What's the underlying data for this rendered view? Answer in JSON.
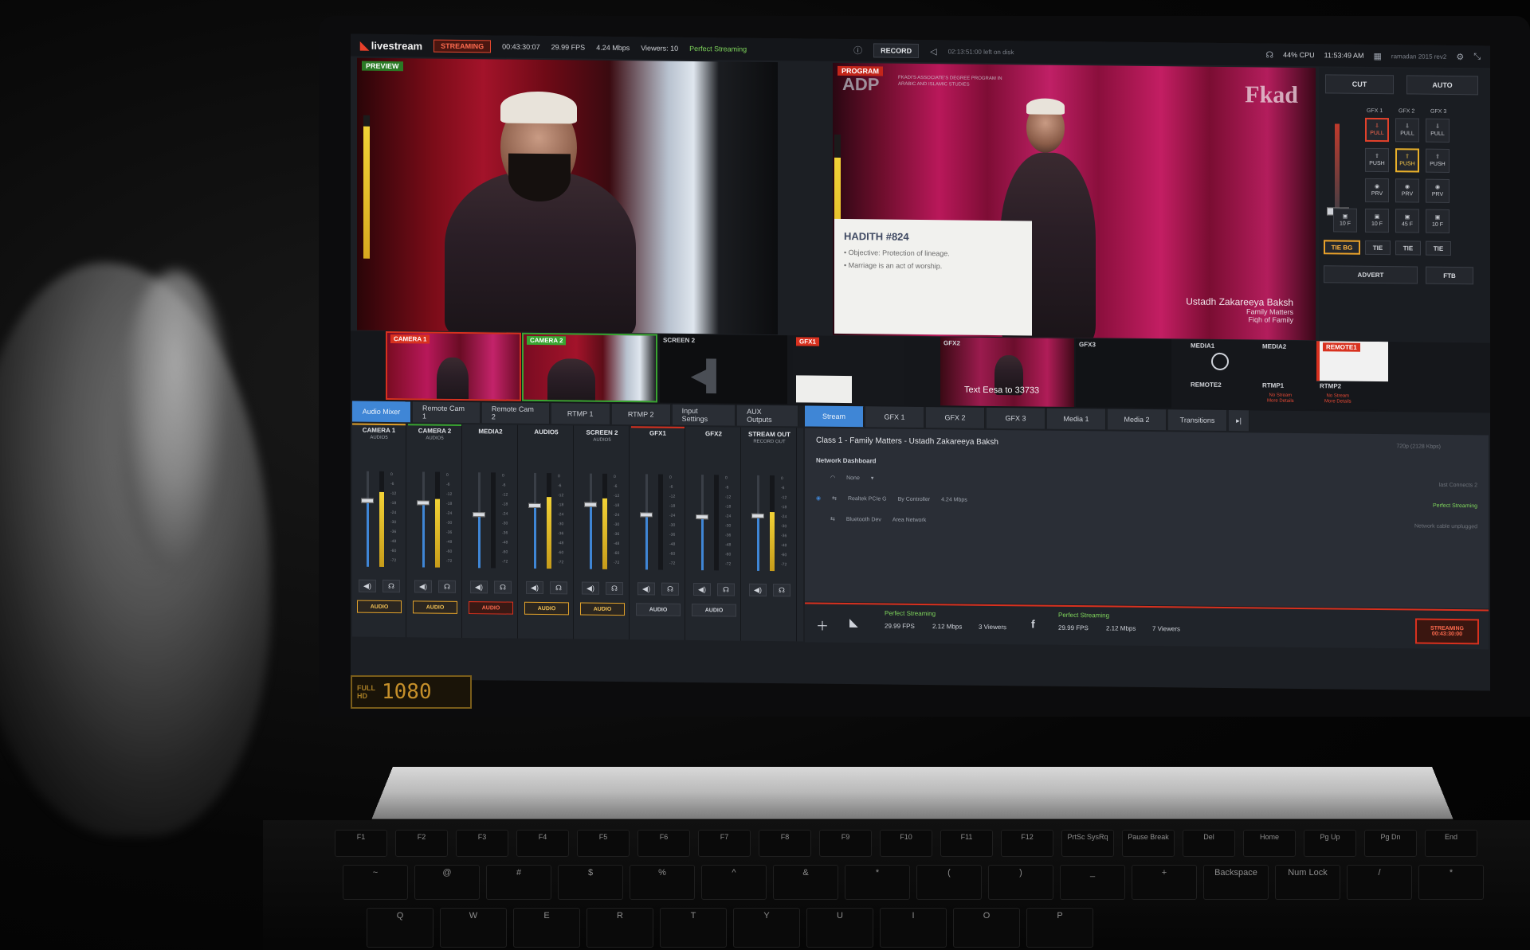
{
  "topbar": {
    "logo": "livestream",
    "streaming": "STREAMING",
    "timecode": "00:43:30:07",
    "fps": "29.99 FPS",
    "bitrate": "4.24 Mbps",
    "viewers": "Viewers: 10",
    "status": "Perfect Streaming",
    "record": "RECORD",
    "disk": "02:13:51:00 left on disk",
    "cpu": "44% CPU",
    "clock": "11:53:49 AM",
    "project": "ramadan 2015 rev2"
  },
  "preview": {
    "label": "PREVIEW"
  },
  "program": {
    "label": "PROGRAM",
    "adp": "ADP",
    "adp_sub": "FKADI'S ASSOCIATE'S DEGREE PROGRAM IN ARABIC AND ISLAMIC STUDIES",
    "brand": "Fkad",
    "card_title": "HADITH #824",
    "card_items": [
      "Objective: Protection of lineage.",
      "Marriage is an act of worship."
    ],
    "name": "Ustadh Zakareeya Baksh",
    "name_sub1": "Family Matters",
    "name_sub2": "Fiqh of Family"
  },
  "transition": {
    "cut": "CUT",
    "auto": "AUTO",
    "heads": [
      "GFX 1",
      "GFX 2",
      "GFX 3"
    ],
    "pull": "PULL",
    "push": "PUSH",
    "prv": "PRV",
    "frames": [
      "10 F",
      "10 F",
      "45 F",
      "10 F"
    ],
    "tie_bg": "TIE BG",
    "tie": "TIE",
    "advert": "ADVERT",
    "ftb": "FTB"
  },
  "sources": {
    "cam1": "CAMERA 1",
    "cam2": "CAMERA 2",
    "screen2": "SCREEN 2",
    "gfx1": "GFX1",
    "gfx2": "GFX2",
    "gfx2_caption": "Text Eesa to 33733",
    "gfx3": "GFX3",
    "media1": "MEDIA1",
    "media2": "MEDIA2",
    "remote1": "REMOTE1",
    "remote2": "REMOTE2",
    "rtmp1": "RTMP1",
    "rtmp2": "RTMP2",
    "no_stream": "No Stream",
    "more_details": "More Details"
  },
  "tabs_left": [
    "Audio Mixer",
    "Remote Cam 1",
    "Remote Cam 2",
    "RTMP 1",
    "RTMP 2",
    "Input Settings",
    "AUX Outputs"
  ],
  "tabs_right": [
    "Stream",
    "GFX 1",
    "GFX 2",
    "GFX 3",
    "Media 1",
    "Media 2",
    "Transitions"
  ],
  "mixer": {
    "strips": [
      {
        "title": "CAMERA 1",
        "sub": "AUDIO5",
        "fader": 0.72,
        "meter": 0.78,
        "button": "AUDIO",
        "btn_style": "yellow",
        "marker": "#e0a12b"
      },
      {
        "title": "CAMERA 2",
        "sub": "AUDIO5",
        "fader": 0.7,
        "meter": 0.72,
        "button": "AUDIO",
        "btn_style": "yellow",
        "marker": "#39a531"
      },
      {
        "title": "MEDIA2",
        "sub": "",
        "fader": 0.58,
        "meter": 0.0,
        "button": "AUDIO",
        "btn_style": "red",
        "marker": "#22262c"
      },
      {
        "title": "AUDIO5",
        "sub": "",
        "fader": 0.68,
        "meter": 0.75,
        "button": "AUDIO",
        "btn_style": "yellow",
        "marker": "#22262c"
      },
      {
        "title": "SCREEN 2",
        "sub": "AUDIO5",
        "fader": 0.7,
        "meter": 0.74,
        "button": "AUDIO",
        "btn_style": "yellow",
        "marker": "#22262c"
      },
      {
        "title": "GFX1",
        "sub": "",
        "fader": 0.6,
        "meter": 0.0,
        "button": "AUDIO",
        "btn_style": "plain",
        "marker": "#d8311f"
      },
      {
        "title": "GFX2",
        "sub": "",
        "fader": 0.58,
        "meter": 0.0,
        "button": "AUDIO",
        "btn_style": "plain",
        "marker": "#22262c"
      },
      {
        "title": "STREAM OUT",
        "sub": "RECORD OUT",
        "fader": 0.6,
        "meter": 0.62,
        "button": "",
        "btn_style": "none",
        "marker": "#22262c"
      }
    ],
    "scale": [
      "0",
      "-6",
      "-12",
      "-18",
      "-24",
      "-30",
      "-36",
      "-48",
      "-60",
      "-72"
    ]
  },
  "stream": {
    "title": "Class 1 - Family Matters - Ustadh Zakareeya Baksh",
    "res": "720p (2128 Kbps)",
    "dashboard": "Network Dashboard",
    "none": "None",
    "row1_name": "Realtek PCIe G",
    "row1_type": "By Controller",
    "row1_rate": "4.24 Mbps",
    "row1_status": "Perfect Streaming",
    "row2_name": "Bluetooth Dev",
    "row2_type": "Area Network",
    "row2_status": "Network cable unplugged",
    "conn": "last Connects 2"
  },
  "stream_bottom": {
    "ls_status": "Perfect Streaming",
    "ls_fps": "29.99 FPS",
    "ls_rate": "2.12 Mbps",
    "ls_viewers": "3 Viewers",
    "fb_status": "Perfect Streaming",
    "fb_fps": "29.99 FPS",
    "fb_rate": "2.12 Mbps",
    "fb_viewers": "7 Viewers",
    "stream_btn": "STREAMING",
    "stream_time": "00:43:30:00"
  },
  "hd": {
    "top": "FULL",
    "bottom": "HD",
    "res": "1080"
  },
  "keys": {
    "fn": [
      "F1",
      "F2",
      "F3",
      "F4",
      "F5",
      "F6",
      "F7",
      "F8",
      "F9",
      "F10",
      "F11",
      "F12",
      "PrtSc SysRq",
      "Pause Break",
      "Del",
      "Home",
      "Pg Up",
      "Pg Dn",
      "End"
    ],
    "num": [
      "~",
      "@",
      "#",
      "$",
      "%",
      "^",
      "&",
      "*",
      "(",
      ")",
      "_",
      "+",
      "Backspace",
      "Num Lock",
      "/",
      "*"
    ],
    "letters": [
      "Q",
      "W",
      "E",
      "R",
      "T",
      "Y",
      "U",
      "I",
      "O",
      "P"
    ]
  }
}
